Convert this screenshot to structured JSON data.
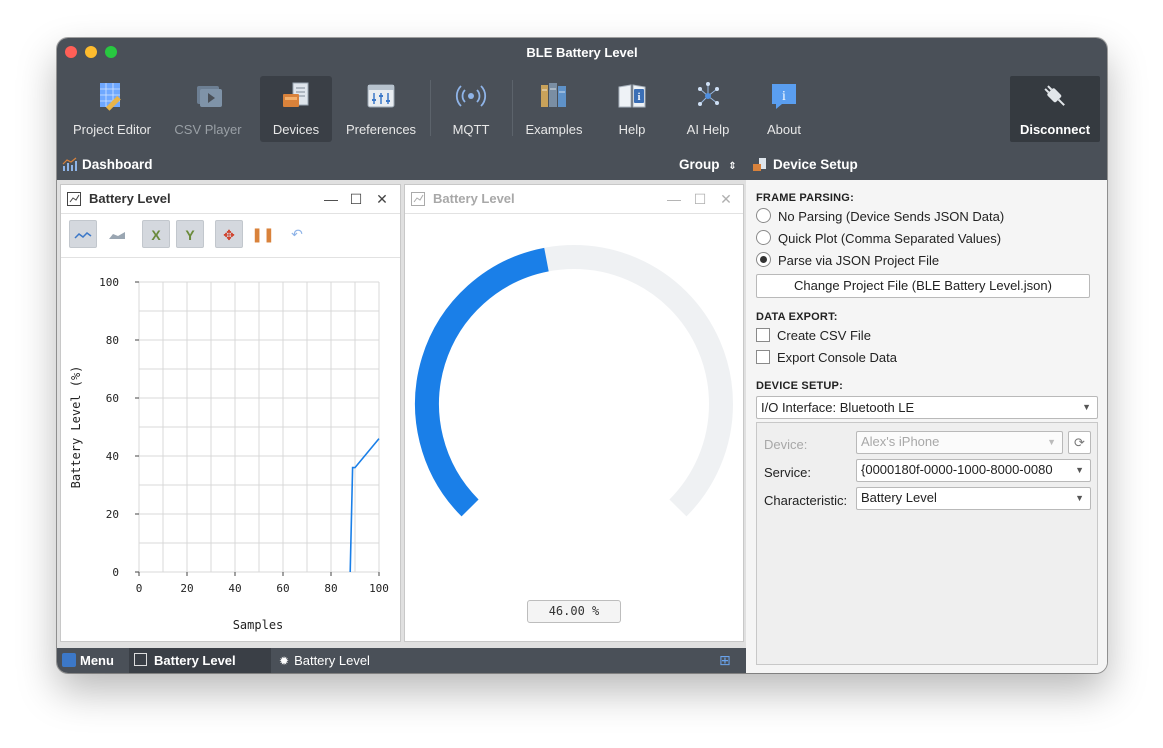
{
  "window": {
    "title": "BLE Battery Level"
  },
  "toolbar": {
    "items": [
      {
        "label": "Project Editor",
        "icon": "project-editor-icon"
      },
      {
        "label": "CSV Player",
        "icon": "csv-player-icon"
      },
      {
        "label": "Devices",
        "icon": "devices-icon"
      },
      {
        "label": "Preferences",
        "icon": "preferences-icon"
      },
      {
        "label": "MQTT",
        "icon": "mqtt-icon"
      },
      {
        "label": "Examples",
        "icon": "examples-icon"
      },
      {
        "label": "Help",
        "icon": "help-icon"
      },
      {
        "label": "AI Help",
        "icon": "ai-help-icon"
      },
      {
        "label": "About",
        "icon": "about-icon"
      }
    ],
    "disconnect_label": "Disconnect"
  },
  "dashboard": {
    "title": "Dashboard",
    "group_label": "Group"
  },
  "plot_widget": {
    "title": "Battery Level",
    "controls": [
      "—",
      "☐",
      "✕"
    ]
  },
  "gauge_widget": {
    "title": "Battery Level",
    "value_label": "46.00 %",
    "value": 46.0,
    "max": 100
  },
  "chart_data": {
    "type": "line",
    "xlabel": "Samples",
    "ylabel": "Battery Level (%)",
    "xlim": [
      0,
      100
    ],
    "ylim": [
      0,
      100
    ],
    "x_ticks": [
      "0",
      "20",
      "40",
      "60",
      "80",
      "100"
    ],
    "y_ticks": [
      "0",
      "20",
      "40",
      "60",
      "80",
      "100"
    ],
    "grid": true,
    "series": [
      {
        "x": [
          88,
          89,
          90,
          100
        ],
        "y": [
          0,
          36,
          36,
          46
        ],
        "color": "#1a7fe8"
      }
    ]
  },
  "statusbar": {
    "menu_label": "Menu",
    "tabs": [
      "Battery Level",
      "Battery Level"
    ]
  },
  "setup": {
    "title": "Device Setup",
    "frame_parsing": {
      "title": "FRAME PARSING:",
      "options": [
        "No Parsing (Device Sends JSON Data)",
        "Quick Plot (Comma Separated Values)",
        "Parse via JSON Project File"
      ],
      "selected": 2,
      "change_button": "Change Project File (BLE Battery Level.json)"
    },
    "data_export": {
      "title": "DATA EXPORT:",
      "options": [
        "Create CSV File",
        "Export Console Data"
      ]
    },
    "device_setup": {
      "title": "DEVICE SETUP:",
      "interface": "I/O Interface: Bluetooth LE",
      "device_label": "Device:",
      "device_value": "Alex's iPhone",
      "service_label": "Service:",
      "service_value": "{0000180f-0000-1000-8000-0080",
      "characteristic_label": "Characteristic:",
      "characteristic_value": "Battery Level"
    }
  },
  "colors": {
    "accent": "#1a7fe8",
    "toolbar": "#4a5058"
  }
}
